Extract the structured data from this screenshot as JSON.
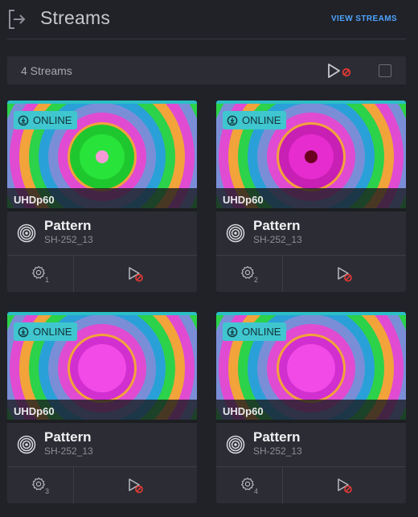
{
  "header": {
    "title": "Streams",
    "view_streams_label": "VIEW STREAMS",
    "exit_icon": "exit-arrow-icon"
  },
  "toolbar": {
    "count_label": "4 Streams",
    "play_all_icon": "play-disabled-icon",
    "select_all_icon": "checkbox-icon"
  },
  "colors": {
    "accent": "#2bbfc6",
    "badge_bg": "#3fc6cf",
    "link": "#4da3ff",
    "stop_red": "#e53935",
    "bg": "#212228",
    "card_bg": "#2c2d34"
  },
  "cards": [
    {
      "status": "ONLINE",
      "resolution": "UHDp60",
      "name": "Pattern",
      "id": "SH-252_13",
      "settings_num": "1",
      "center": "green"
    },
    {
      "status": "ONLINE",
      "resolution": "UHDp60",
      "name": "Pattern",
      "id": "SH-252_13",
      "settings_num": "2",
      "center": "magenta"
    },
    {
      "status": "ONLINE",
      "resolution": "UHDp60",
      "name": "Pattern",
      "id": "SH-252_13",
      "settings_num": "3",
      "center": "magenta"
    },
    {
      "status": "ONLINE",
      "resolution": "UHDp60",
      "name": "Pattern",
      "id": "SH-252_13",
      "settings_num": "4",
      "center": "magenta"
    }
  ]
}
